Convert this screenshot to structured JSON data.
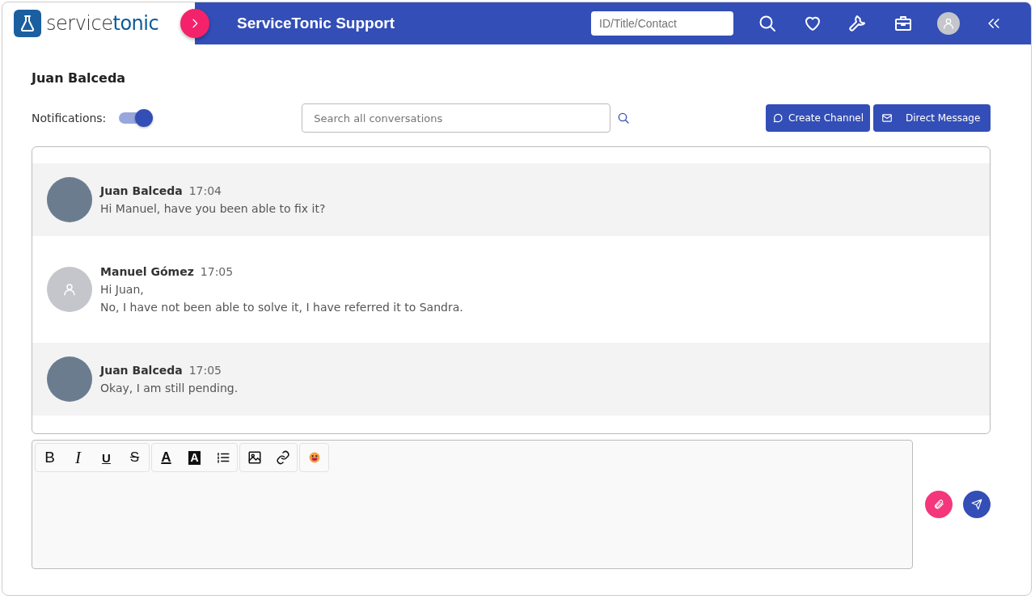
{
  "header": {
    "logo": "service**tonic**",
    "title": "ServiceTonic Support",
    "search": {
      "placeholder": "ID/Title/Contact"
    }
  },
  "page": {
    "title": "Juan Balceda",
    "notifications": {
      "label": "Notifications:",
      "on": true
    },
    "search": {
      "placeholder": "Search all conversations"
    },
    "buttons": [
      {
        "kind": "channel",
        "label": "Create Channel"
      },
      {
        "kind": "mail",
        "label": "Direct Message"
      }
    ]
  },
  "messages": [
    {
      "kind": "photo",
      "author": "Juan Balceda",
      "time": "17:04",
      "lines": [
        "Hi Manuel, have you been able to fix it?"
      ]
    },
    {
      "kind": "default",
      "author": "Manuel Gómez",
      "time": "17:05",
      "lines": [
        "Hi Juan,",
        "No, I have not been able to solve it, I have referred it to Sandra."
      ]
    },
    {
      "kind": "photo",
      "author": "Juan Balceda",
      "time": "17:05",
      "lines": [
        "Okay, I am still pending."
      ]
    }
  ],
  "toolbar": [
    [
      {
        "kind": "bold",
        "label": "B"
      },
      {
        "kind": "italic",
        "label": "I"
      },
      {
        "kind": "underline",
        "label": "U"
      },
      {
        "kind": "strike",
        "label": "S"
      }
    ],
    [
      {
        "kind": "color",
        "label": "A"
      },
      {
        "kind": "background",
        "label": "A"
      },
      {
        "kind": "list"
      }
    ],
    [
      {
        "kind": "image"
      },
      {
        "kind": "link"
      }
    ],
    [
      {
        "kind": "emoji"
      }
    ]
  ]
}
